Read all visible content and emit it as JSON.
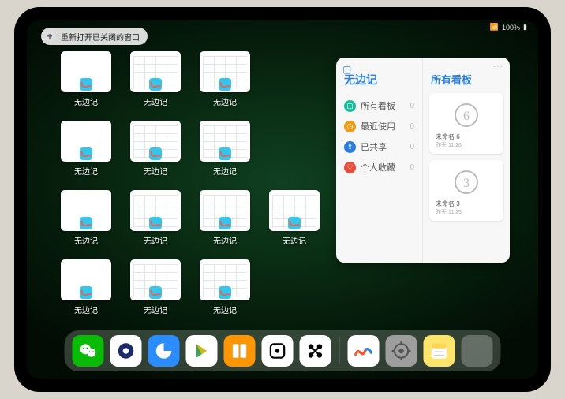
{
  "status": {
    "battery": "100%",
    "signal": "••••"
  },
  "top_button": {
    "plus": "+",
    "label": "重新打开已关闭的窗口"
  },
  "thumbnails": {
    "app_label": "无边记",
    "items": [
      {
        "variant": "blank"
      },
      {
        "variant": "grid"
      },
      {
        "variant": "grid"
      },
      {
        "variant": "blank"
      },
      {
        "variant": "grid"
      },
      {
        "variant": "grid"
      },
      {
        "variant": "blank"
      },
      {
        "variant": "grid"
      },
      {
        "variant": "grid"
      },
      {
        "variant": "grid"
      },
      {
        "variant": "blank"
      },
      {
        "variant": "grid"
      },
      {
        "variant": "grid"
      }
    ]
  },
  "panel": {
    "left_title": "无边记",
    "right_title": "所有看板",
    "more": "···",
    "rows": [
      {
        "icon_color": "#1abc9c",
        "glyph": "▢",
        "label": "所有看板",
        "count": "0"
      },
      {
        "icon_color": "#f39c12",
        "glyph": "◷",
        "label": "最近使用",
        "count": "0"
      },
      {
        "icon_color": "#2b7de1",
        "glyph": "⇪",
        "label": "已共享",
        "count": "0"
      },
      {
        "icon_color": "#e74c3c",
        "glyph": "♡",
        "label": "个人收藏",
        "count": "0"
      }
    ],
    "boards": [
      {
        "digit": "6",
        "caption": "未命名 6",
        "sub": "昨天 11:26"
      },
      {
        "digit": "3",
        "caption": "未命名 3",
        "sub": "昨天 11:25"
      }
    ]
  },
  "dock": {
    "apps": [
      {
        "name": "wechat",
        "bg": "#09bb07"
      },
      {
        "name": "quark",
        "bg": "#ffffff"
      },
      {
        "name": "qqbrowser",
        "bg": "#2a8cff"
      },
      {
        "name": "play",
        "bg": "#ffffff"
      },
      {
        "name": "books",
        "bg": "#ff9500"
      },
      {
        "name": "dice",
        "bg": "#ffffff"
      },
      {
        "name": "connect",
        "bg": "#ffffff"
      },
      {
        "name": "freeform",
        "bg": "#ffffff"
      },
      {
        "name": "settings",
        "bg": "#9e9e9e"
      },
      {
        "name": "notes",
        "bg": "#ffe46b"
      }
    ]
  }
}
